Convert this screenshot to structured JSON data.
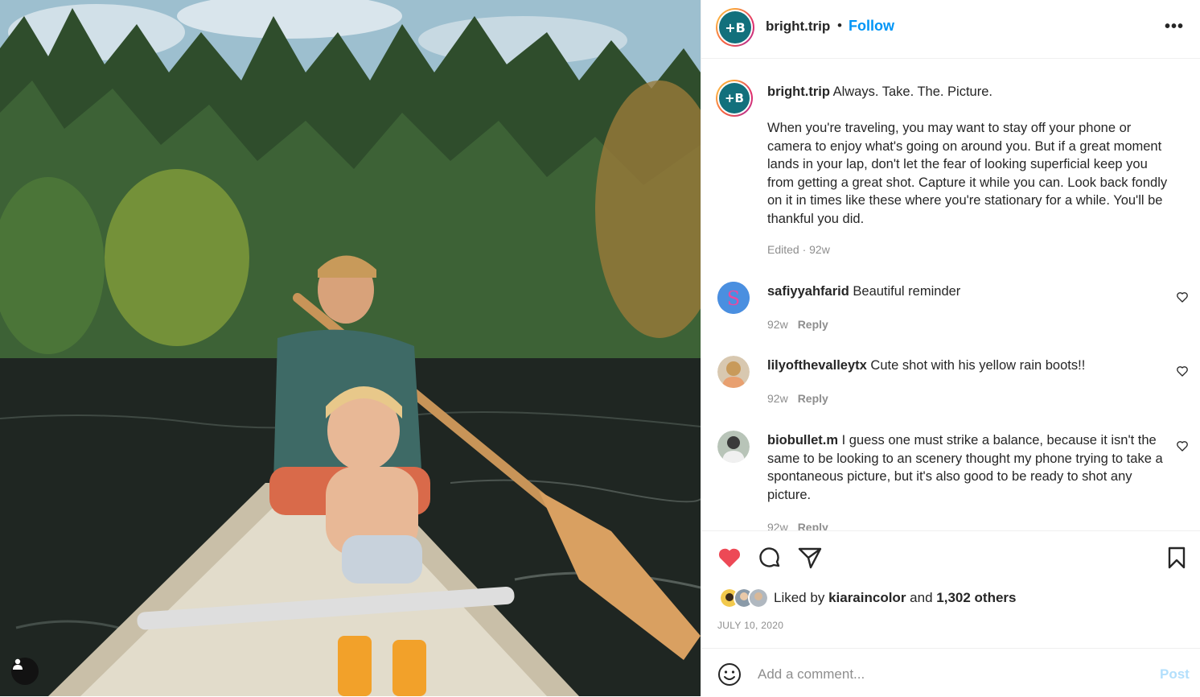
{
  "post": {
    "username": "bright.trip",
    "separator": "•",
    "follow_label": "Follow",
    "more_label": "•••",
    "avatar_letter": "+B"
  },
  "caption": {
    "username": "bright.trip",
    "title": "Always. Take. The. Picture.",
    "body": "When you're traveling, you may want to stay off your phone or camera to enjoy what's going on around you. But if a great moment lands in your lap, don't let the fear of looking superficial keep you from getting a great shot. Capture it while you can. Look back fondly on it in times like these where you're stationary for a while. You'll be thankful you did.",
    "meta": "Edited · 92w"
  },
  "comments": [
    {
      "username": "safiyyahfarid",
      "text": "Beautiful reminder",
      "age": "92w",
      "reply": "Reply",
      "avatar_color": "#3a7bd5"
    },
    {
      "username": "lilyofthevalleytx",
      "text": "Cute shot with his yellow rain boots!!",
      "age": "92w",
      "reply": "Reply",
      "avatar_color": "#c89a5a"
    },
    {
      "username": "biobullet.m",
      "text": "I guess one must strike a balance, because it isn't the same to be looking to an scenery thought my phone trying to take a spontaneous picture, but it's also good to be ready to shot any picture.",
      "age": "92w",
      "reply": "Reply",
      "avatar_color": "#7a8a7a"
    }
  ],
  "likes": {
    "prefix": "Liked by",
    "user": "kiaraincolor",
    "middle": "and",
    "others": "1,302 others"
  },
  "date": "JULY 10, 2020",
  "composer": {
    "placeholder": "Add a comment...",
    "post_label": "Post"
  },
  "colors": {
    "accent": "#0095f6",
    "like_red": "#ed4956",
    "muted": "#8e8e8e",
    "post_disabled": "#b2dffc",
    "brand_teal": "#12707c"
  },
  "icons": [
    "heart-filled-icon",
    "comment-icon",
    "share-icon",
    "bookmark-icon",
    "emoji-icon",
    "heart-outline-icon",
    "user-tag-icon",
    "more-icon"
  ]
}
